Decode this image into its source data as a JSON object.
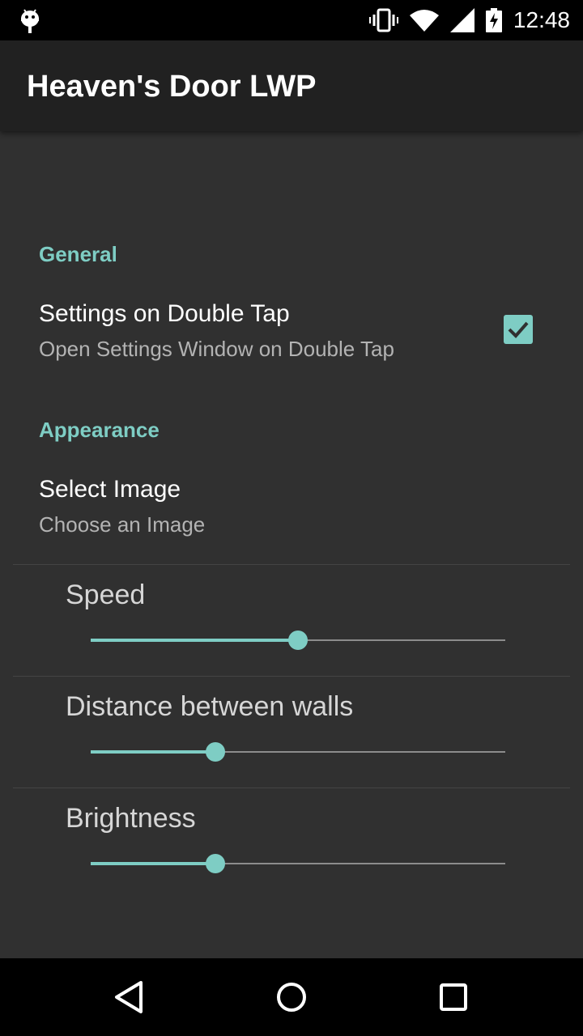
{
  "status_bar": {
    "time": "12:48",
    "icons": [
      "android-debug-icon",
      "vibrate-icon",
      "wifi-icon",
      "signal-icon",
      "battery-charging-icon"
    ]
  },
  "app_bar": {
    "title": "Heaven's Door LWP"
  },
  "preferences": {
    "general": {
      "header": "General",
      "double_tap": {
        "title": "Settings on Double Tap",
        "summary": "Open Settings Window on Double Tap",
        "checked": true
      }
    },
    "appearance": {
      "header": "Appearance",
      "select_image": {
        "title": "Select Image",
        "summary": "Choose an Image"
      },
      "sliders": [
        {
          "label": "Speed",
          "value": 0.5
        },
        {
          "label": "Distance between walls",
          "value": 0.3
        },
        {
          "label": "Brightness",
          "value": 0.3
        }
      ]
    }
  },
  "colors": {
    "accent": "#7ecdc4",
    "background": "#303030",
    "app_bar": "#212121"
  },
  "nav_bar": {
    "icons": [
      "back-icon",
      "home-icon",
      "recents-icon"
    ]
  }
}
